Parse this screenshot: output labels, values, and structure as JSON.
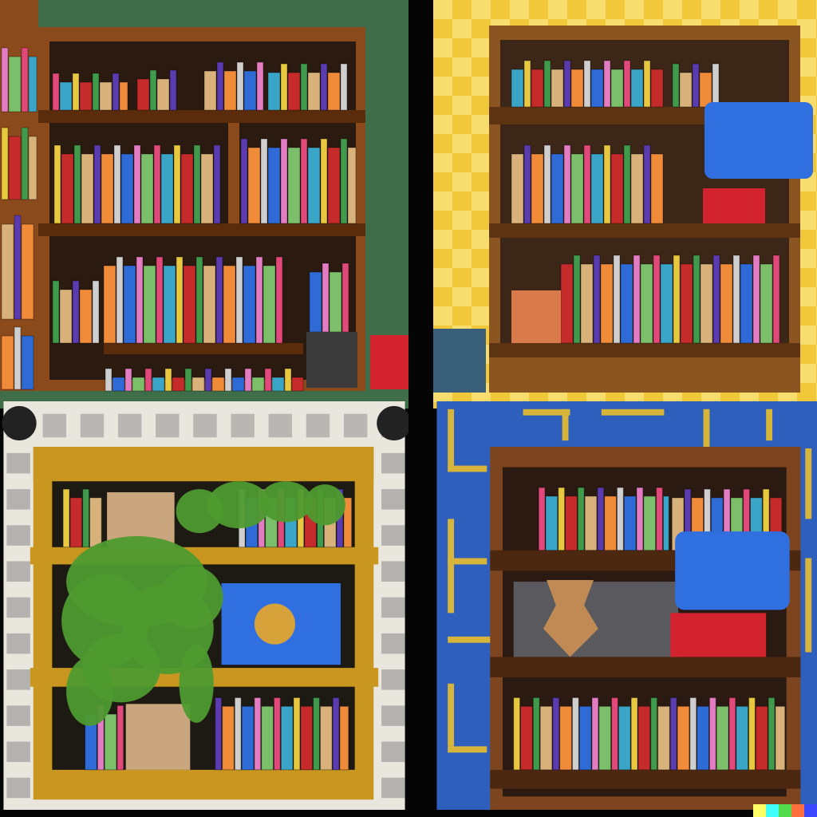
{
  "panels": [
    {
      "id": "top-left",
      "background": "#3f6d4a",
      "wood": "#8b4a1c",
      "wood_dark": "#5a2c0c",
      "back": "#2b1a10"
    },
    {
      "id": "top-right",
      "background": "#f1c83a",
      "checker": "#f7dd6e",
      "wood": "#8a5520",
      "wood_dark": "#5c3412",
      "back": "#3b2618"
    },
    {
      "id": "bottom-left",
      "background": "#e9e6de",
      "tile": "#8f8f8f",
      "wood": "#c9961f",
      "wood_dark": "#8d6612",
      "back": "#1d1a14"
    },
    {
      "id": "bottom-right",
      "background": "#2f5fbd",
      "pattern": "#d6b53a",
      "wood": "#7d451f",
      "wood_dark": "#4d2810",
      "back": "#2a1a12"
    }
  ],
  "book_colors": [
    "#e0497a",
    "#3aa5c7",
    "#e7c83e",
    "#c62b2b",
    "#3f9a4c",
    "#d8b27a",
    "#5a3bb0",
    "#f08b3a",
    "#cfcfcf",
    "#2f6bd6",
    "#e37cc2",
    "#7bbf6a"
  ],
  "accents": {
    "blue_box": "#2f6fe0",
    "red_box": "#d2232f",
    "plant": "#4e9a2f",
    "gold_shell": "#d8a23a",
    "vase": "#c18a55"
  },
  "watermark_colors": [
    "#ffff66",
    "#42ffff",
    "#51da4c",
    "#ff6e3c",
    "#3c46ff"
  ]
}
